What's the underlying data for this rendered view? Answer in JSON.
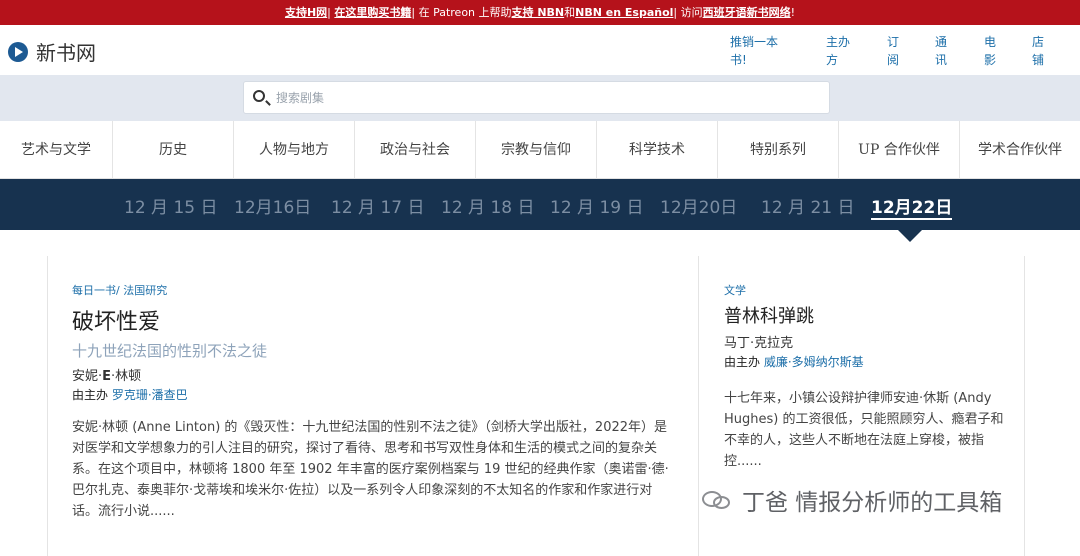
{
  "banner": {
    "link_support_h": "支持H网",
    "sep1": "| ",
    "link_buy_books": "在这里购买书籍",
    "mid1": "| 在 Patreon 上帮助",
    "link_support_nbn": "支持 NBN",
    "and": "和",
    "link_nbn_es": "NBN en Español",
    "mid2": "| 访问",
    "link_spanish": "西班牙语新书网络",
    "end": "!"
  },
  "header": {
    "logo_text": "新书网",
    "nav": [
      {
        "label": "推销一本书!"
      },
      {
        "label": "主办方"
      },
      {
        "label": "订阅"
      },
      {
        "label": "通讯"
      },
      {
        "label": "电影"
      },
      {
        "label": "店铺"
      }
    ]
  },
  "search": {
    "placeholder": "搜索剧集",
    "icon": "search-icon"
  },
  "categories": [
    "艺术与文学",
    "历史",
    "人物与地方",
    "政治与社会",
    "宗教与信仰",
    "科学技术",
    "特别系列",
    "UP 合作伙伴",
    "学术合作伙伴"
  ],
  "dates": [
    {
      "label": "12 月 15 日",
      "active": false
    },
    {
      "label": "12月16日",
      "active": false
    },
    {
      "label": "12 月 17 日",
      "active": false
    },
    {
      "label": "12 月 18 日",
      "active": false
    },
    {
      "label": "12 月 19 日",
      "active": false
    },
    {
      "label": "12月20日",
      "active": false
    },
    {
      "label": "12 月 21 日",
      "active": false
    },
    {
      "label": "12月22日",
      "active": true
    }
  ],
  "main_book": {
    "kicker_prefix": "每日一书",
    "kicker_sep": "/ ",
    "kicker_category": "法国研究",
    "title": "破坏性爱",
    "subtitle": "十九世纪法国的性别不法之徒",
    "author_a": "安妮·",
    "author_b": "E",
    "author_c": "·林顿",
    "host_prefix": "由主办",
    "host_name": "罗克珊·潘查巴",
    "description": "安妮·林顿 (Anne Linton) 的《毁灭性：十九世纪法国的性别不法之徒》（剑桥大学出版社，2022年）是对医学和文学想象力的引人注目的研究，探讨了看待、思考和书写双性身体和生活的模式之间的复杂关系。在这个项目中，林顿将 1800 年至 1902 年丰富的医疗案例档案与 19 世纪的经典作家（奥诺雷·德·巴尔扎克、泰奥菲尔·戈蒂埃和埃米尔·佐拉）以及一系列令人印象深刻的不太知名的作家和作家进行对话。流行小说......"
  },
  "side_book": {
    "kicker": "文学",
    "title": "普林科弹跳",
    "author": "马丁·克拉克",
    "host_prefix": "由主办",
    "host_name": "威廉·多姆纳尔斯基",
    "description": "十七年来，小镇公设辩护律师安迪·休斯 (Andy Hughes) 的工资很低，只能照顾穷人、瘾君子和不幸的人，这些人不断地在法庭上穿梭，被指控......"
  },
  "watermark": {
    "text": "丁爸 情报分析师的工具箱",
    "icon": "wechat-icon"
  }
}
